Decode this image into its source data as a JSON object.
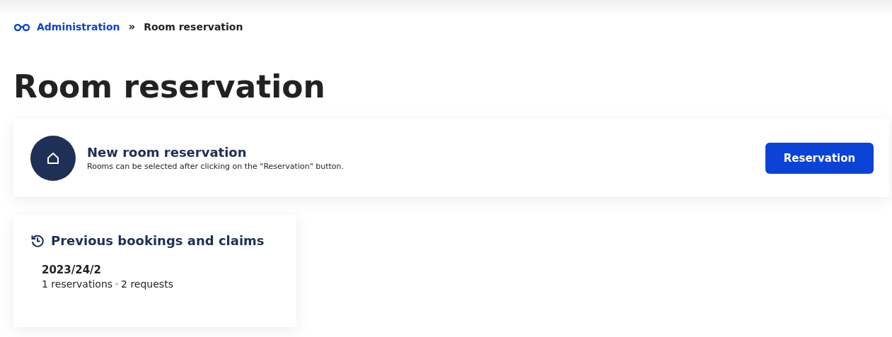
{
  "breadcrumb": {
    "items": [
      {
        "label": "Administration",
        "kind": "link"
      },
      {
        "label": "»",
        "kind": "separator"
      },
      {
        "label": "Room reservation",
        "kind": "current"
      }
    ]
  },
  "title": "Room reservation",
  "new_reservation": {
    "heading": "New room reservation",
    "description": "Rooms can be selected after clicking on the \"Reservation\" button.",
    "button": "Reservation"
  },
  "previous": {
    "heading": "Previous bookings and claims",
    "entries": [
      {
        "period": "2023/24/2",
        "reservations": "1 reservations",
        "requests": "2 requests"
      }
    ]
  }
}
